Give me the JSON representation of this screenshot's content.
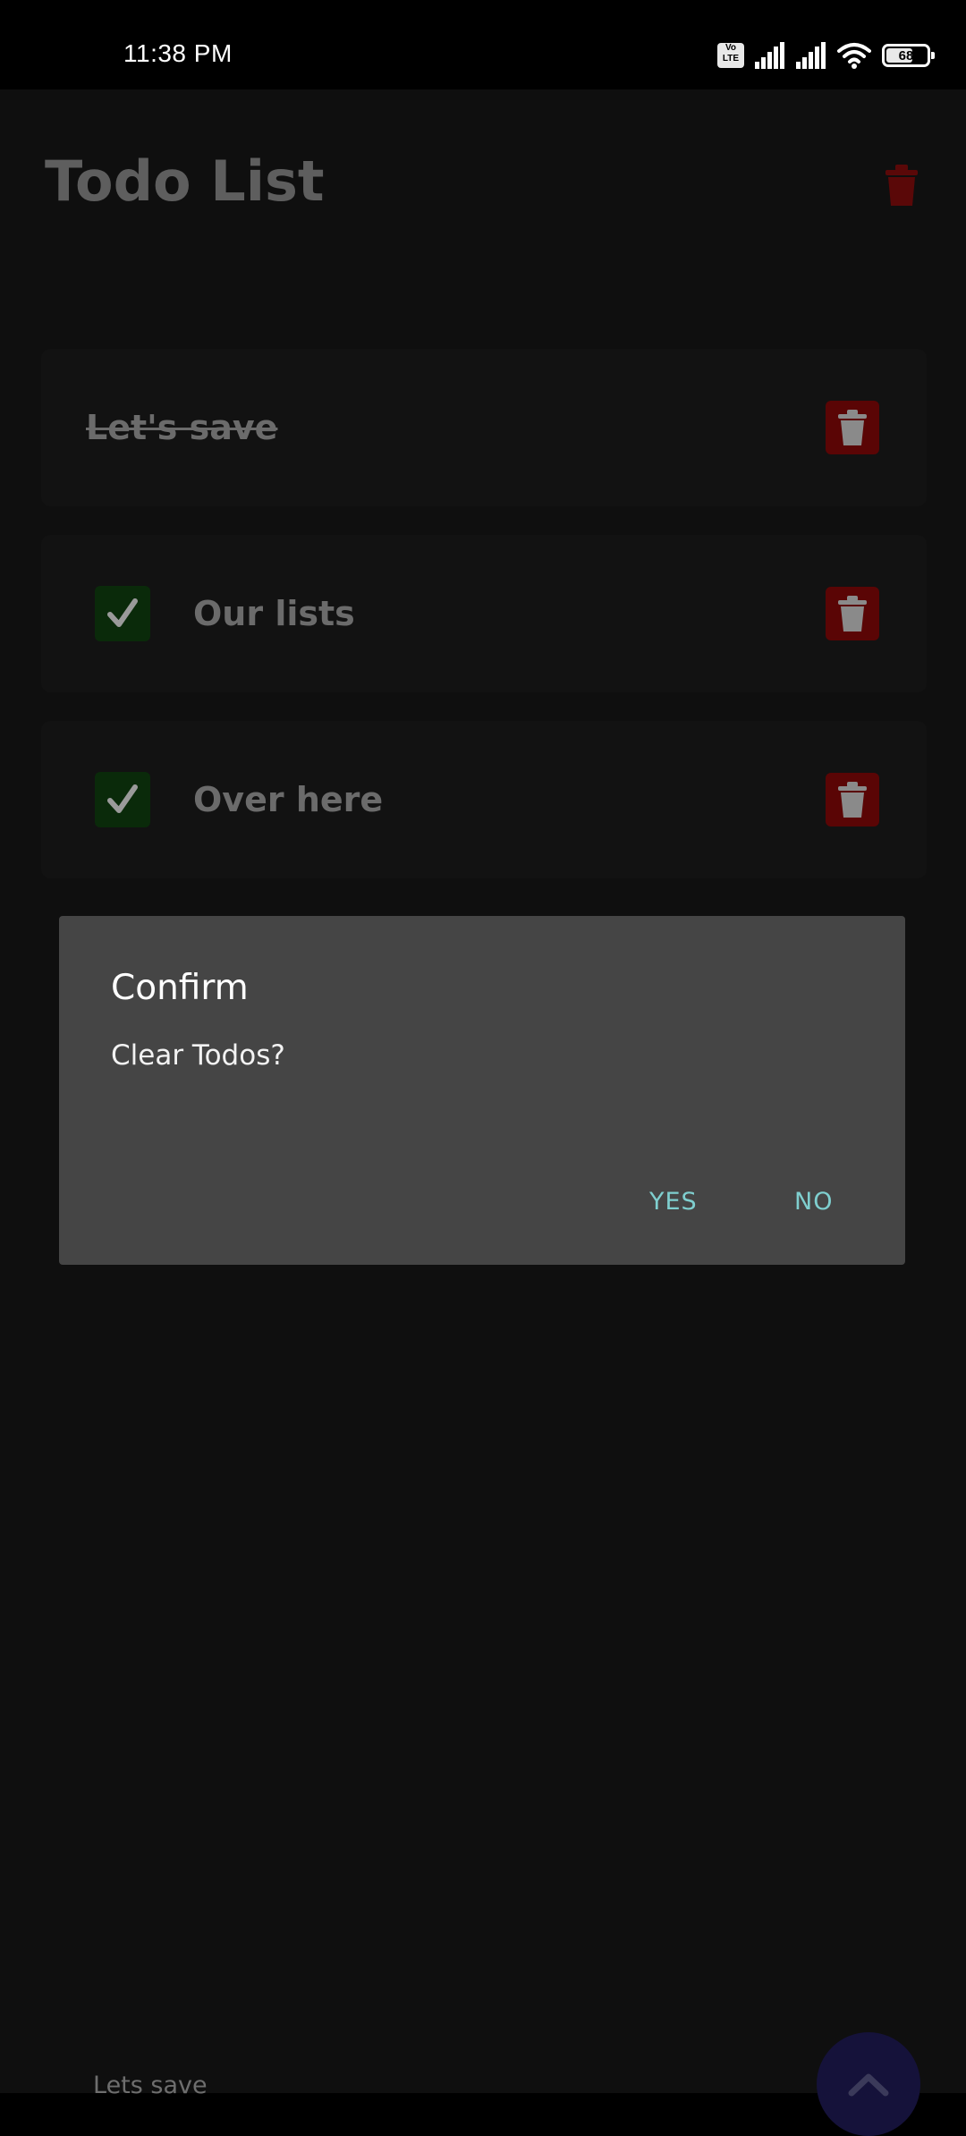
{
  "status_bar": {
    "time": "11:38 PM",
    "volte_label": "Vo LTE",
    "battery_level": "68",
    "battery_fraction": 0.68,
    "icons": [
      "volte-icon",
      "signal-icon",
      "signal-icon",
      "wifi-icon",
      "battery-icon"
    ]
  },
  "app": {
    "title": "Todo List",
    "header_action_icon": "trash-icon",
    "todos": [
      {
        "text": "Let's save",
        "completed": true,
        "has_checkbox": false
      },
      {
        "text": "Our lists",
        "completed": false,
        "has_checkbox": true,
        "checked": true
      },
      {
        "text": "Over here",
        "completed": false,
        "has_checkbox": true,
        "checked": true
      }
    ],
    "input_text": "Lets save",
    "fab_icon": "chevron-up-icon"
  },
  "dialog": {
    "title": "Confirm",
    "message": "Clear Todos?",
    "yes_label": "YES",
    "no_label": "NO"
  },
  "colors": {
    "accent": "#7fcfcf",
    "danger": "#5a0505",
    "success": "#0a2a0a",
    "fab": "#15123a",
    "dialog_bg": "#454545"
  }
}
